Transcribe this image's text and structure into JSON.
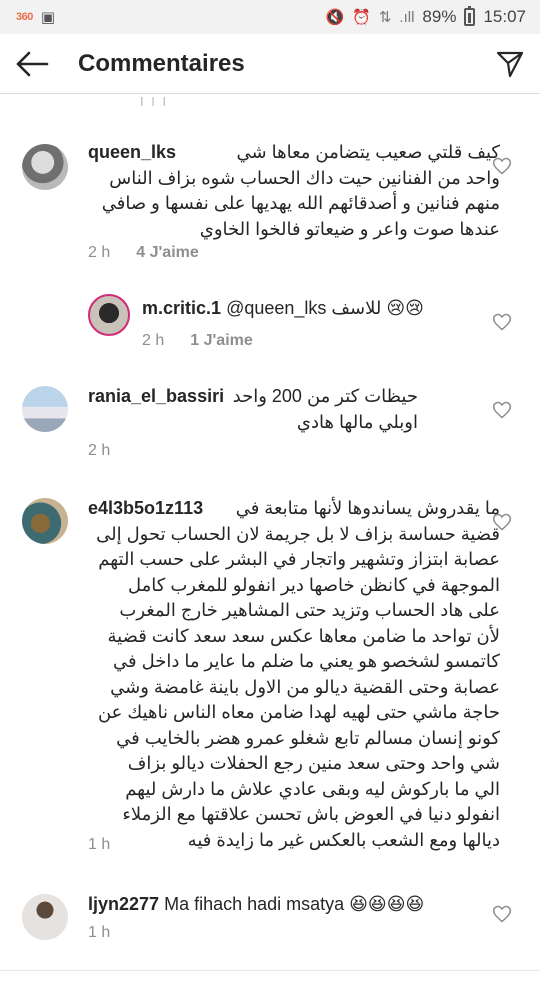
{
  "status_bar": {
    "app_badge": "360",
    "battery_percent": "89%",
    "time": "15:07"
  },
  "header": {
    "title": "Commentaires"
  },
  "prev_remnant": "I I I",
  "comments": [
    {
      "username": "queen_lks",
      "lines": [
        "كيف قلتي صعيب يتضامن معاها شي",
        "واحد من الفنانين  حيت داك الحساب شوه بزاف الناس",
        "منهم فنانين و أصدقائهم الله يهديها على نفسها و صافي",
        "عندها صوت واعر و ضيعاتو فالخوا الخاوي"
      ],
      "time": "2 h",
      "likes": "4 J'aime"
    },
    {
      "username": "m.critic.1",
      "mention": "@queen_lks",
      "text": "للاسف 😢😢",
      "time": "2 h",
      "likes": "1 J'aime"
    },
    {
      "username": "rania_el_bassiri",
      "lines": [
        "حيظات كتر من 200 واحد",
        "اوبلي مالها هادي"
      ],
      "time": "2 h"
    },
    {
      "username": "e4l3b5o1z113",
      "lines": [
        "ما يقدروش يساندوها لأنها متابعة في",
        "قضية حساسة بزاف لا بل جريمة لان الحساب تحول إلى",
        "عصابة ابتزاز وتشهير  واتجار في البشر على حسب التهم",
        "الموجهة في كانظن خاصها دير انفولو للمغرب كامل",
        "على هاد الحساب وتزيد حتى المشاهير خارج المغرب",
        "لأن تواحد ما ضامن معاها عكس سعد سعد كانت قضية",
        "كاتمسو لشخصو هو يعني ما ضلم ما عاير ما داخل في",
        "عصابة وحتى القضية ديالو من الاول باينة غامضة وشي",
        "حاجة ماشي حتى لهيه لهدا ضامن معاه الناس ناهيك عن",
        "كونو إنسان مسالم تابع شغلو عمرو هضر بالخايب في",
        "شي واحد وحتى سعد منين رجع الحفلات ديالو بزاف",
        "الي ما باركوش ليه وبقى عادي علاش ما دارش ليهم",
        "انفولو دنيا في العوض باش تحسن علاقتها مع الزملاء",
        "ديالها ومع الشعب بالعكس غير ما زايدة فيه"
      ],
      "time": "1 h"
    },
    {
      "username": "ljyn2277",
      "text": "Ma fihach hadi msatya 😆😆😆😆",
      "time": "1 h"
    }
  ]
}
